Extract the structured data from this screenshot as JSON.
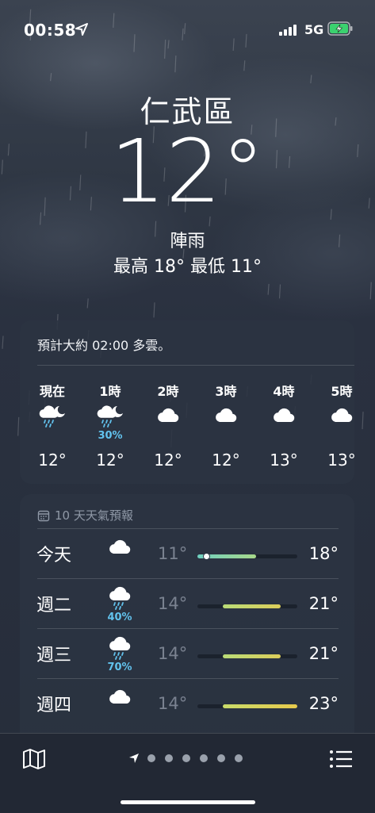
{
  "status": {
    "time": "00:58",
    "network": "5G",
    "icons": [
      "location-arrow-icon",
      "signal-icon",
      "battery-charging-icon"
    ]
  },
  "current": {
    "city": "仁武區",
    "temperature": "12°",
    "condition": "陣雨",
    "high_low": "最高 18°  最低 11°"
  },
  "hourly": {
    "summary": "預計大約 02:00 多雲。",
    "items": [
      {
        "label": "現在",
        "icon": "moon-cloud-rain-icon",
        "precip": "",
        "temp": "12°"
      },
      {
        "label": "1時",
        "icon": "moon-cloud-rain-icon",
        "precip": "30%",
        "temp": "12°"
      },
      {
        "label": "2時",
        "icon": "cloud-icon",
        "precip": "",
        "temp": "12°"
      },
      {
        "label": "3時",
        "icon": "cloud-icon",
        "precip": "",
        "temp": "12°"
      },
      {
        "label": "4時",
        "icon": "cloud-icon",
        "precip": "",
        "temp": "13°"
      },
      {
        "label": "5時",
        "icon": "cloud-icon",
        "precip": "",
        "temp": "13°"
      }
    ]
  },
  "daily": {
    "header": "10 天天氣預報",
    "header_icon": "calendar-icon",
    "range": [
      11,
      23
    ],
    "days": [
      {
        "day": "今天",
        "icon": "cloud-icon",
        "precip": "",
        "low": "11°",
        "high": "18°",
        "low_val": 11,
        "high_val": 18,
        "current_val": 12,
        "color_from": "#6fd0c0",
        "color_to": "#a8d88a"
      },
      {
        "day": "週二",
        "icon": "cloud-rain-icon",
        "precip": "40%",
        "low": "14°",
        "high": "21°",
        "low_val": 14,
        "high_val": 21,
        "current_val": null,
        "color_from": "#b9dc78",
        "color_to": "#dccd5a"
      },
      {
        "day": "週三",
        "icon": "cloud-rain-icon",
        "precip": "70%",
        "low": "14°",
        "high": "21°",
        "low_val": 14,
        "high_val": 21,
        "current_val": null,
        "color_from": "#b9dc78",
        "color_to": "#dccd5a"
      },
      {
        "day": "週四",
        "icon": "cloud-icon",
        "precip": "",
        "low": "14°",
        "high": "23°",
        "low_val": 14,
        "high_val": 23,
        "current_val": null,
        "color_from": "#c9dc6a",
        "color_to": "#e6c94c"
      }
    ]
  },
  "bottom": {
    "page_count": 6,
    "icons": [
      "map-icon",
      "location-arrow-icon",
      "list-icon"
    ]
  }
}
